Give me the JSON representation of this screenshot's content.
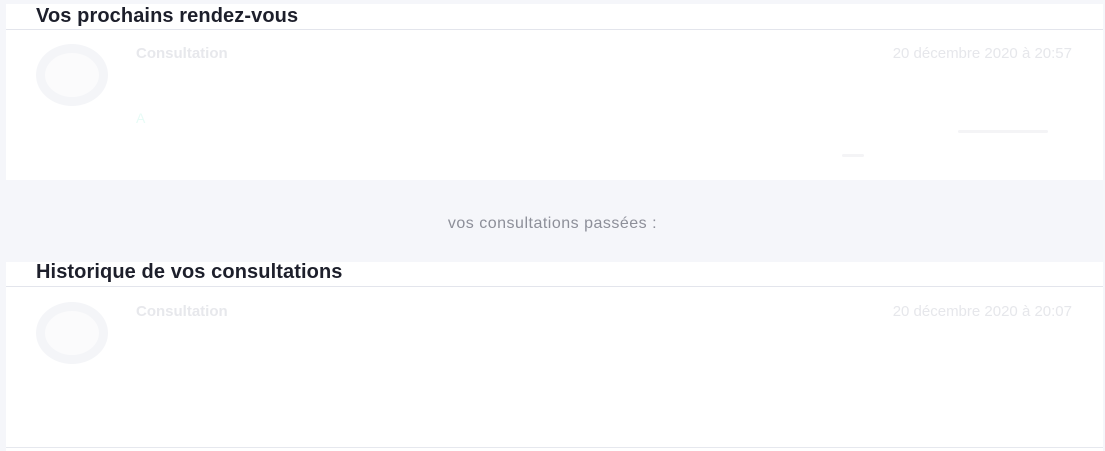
{
  "upcoming": {
    "title": "Vos prochains rendez-vous",
    "appointment": {
      "type": "Consultation",
      "datetime": "20 décembre 2020 à 20:57",
      "link": "A"
    }
  },
  "past_caption": "vos consultations passées :",
  "history": {
    "title": "Historique de vos consultations",
    "appointment": {
      "type": "Consultation",
      "datetime": "20 décembre 2020 à 20:07"
    }
  }
}
